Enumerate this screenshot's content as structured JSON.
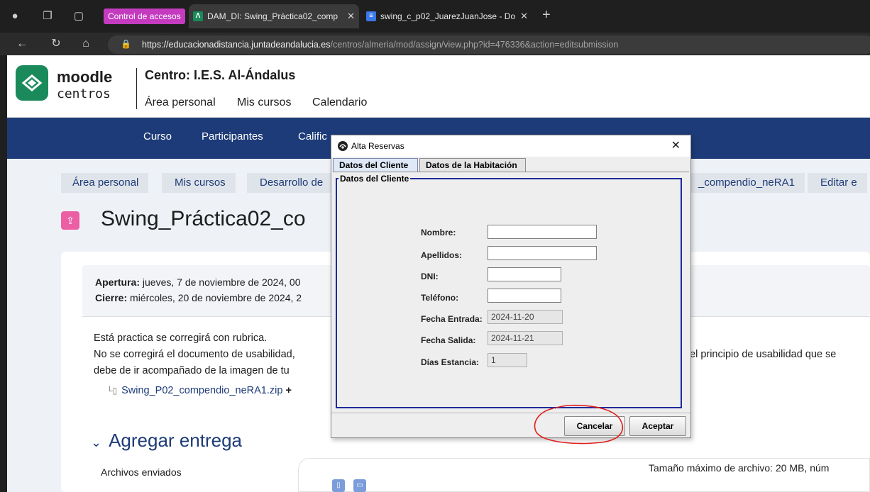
{
  "browser": {
    "tab_group_label": "Control de accesos",
    "tabs": [
      {
        "title": "DAM_DI: Swing_Práctica02_comp",
        "active": true
      },
      {
        "title": "swing_c_p02_JuarezJuanJose - Do",
        "active": false
      }
    ],
    "url_domain": "https://educacionadistancia.juntadeandalucia.es",
    "url_path": "/centros/almeria/mod/assign/view.php?id=476336&action=editsubmission"
  },
  "moodle": {
    "brand_line1": "moodle",
    "brand_line2": "centros",
    "centro": "Centro: I.E.S. Al-Ándalus",
    "nav": [
      "Área personal",
      "Mis cursos",
      "Calendario"
    ],
    "course_nav": [
      "Curso",
      "Participantes",
      "Calific"
    ],
    "breadcrumbs": [
      "Área personal",
      "Mis cursos",
      "Desarrollo de",
      "_compendio_neRA1",
      "Editar e"
    ],
    "page_title": "Swing_Práctica02_co",
    "apertura_label": "Apertura:",
    "apertura_value": " jueves, 7 de noviembre de 2024, 00",
    "cierre_label": "Cierre:",
    "cierre_value": " miércoles, 20 de noviembre de 2024, 2",
    "desc_line1": "Está practica se corregirá con rubrica.",
    "desc_line2": "No se corregirá el documento de usabilidad,",
    "desc_line3": "debe de ir acompañado de la imagen de tu",
    "desc_right": "el principio de usabilidad que se",
    "attachment": "Swing_P02_compendio_neRA1.zip",
    "agregar_heading": "Agregar entrega",
    "archivos_label": "Archivos enviados",
    "tamano": "Tamaño máximo de archivo: 20 MB, núm"
  },
  "dialog": {
    "title": "Alta Reservas",
    "tabs": [
      "Datos del Cliente",
      "Datos de la Habitación"
    ],
    "group_title": "Datos del Cliente",
    "fields": [
      {
        "label": "Nombre:",
        "value": ""
      },
      {
        "label": "Apellidos:",
        "value": ""
      },
      {
        "label": "DNI:",
        "value": ""
      },
      {
        "label": "Teléfono:",
        "value": ""
      },
      {
        "label": "Fecha Entrada:",
        "value": "2024-11-20"
      },
      {
        "label": "Fecha Salida:",
        "value": "2024-11-21"
      },
      {
        "label": "Días Estancia:",
        "value": "1"
      }
    ],
    "cancel_label": "Cancelar",
    "accept_label": "Aceptar"
  },
  "colors": {
    "moodle_nav": "#1d3b78",
    "moodle_logo": "#1a8a5b",
    "group_chip": "#c43bc0",
    "annotation": "#e0201c",
    "titled_border": "#1e2a9c"
  },
  "icons": [
    "profile-icon",
    "collections-icon",
    "tabs-icon",
    "back-icon",
    "reload-icon",
    "home-icon",
    "lock-icon",
    "moodle-logo-icon",
    "assignment-icon",
    "file-icon",
    "java-icon",
    "close-icon"
  ]
}
